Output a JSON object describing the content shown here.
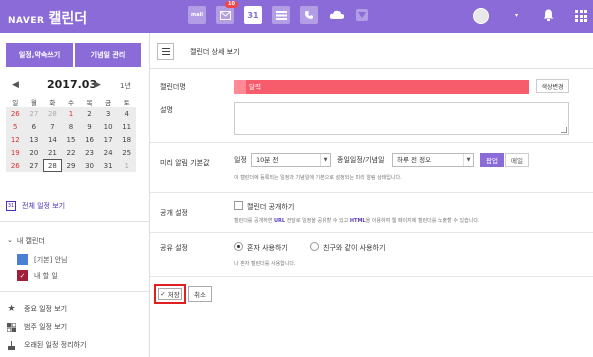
{
  "header": {
    "brand": "NAVER",
    "app_name": "캘린더",
    "apps": [
      {
        "icon": "mail-icon",
        "label": "mail",
        "badge": ""
      },
      {
        "icon": "memo-icon",
        "label": "",
        "badge": "10"
      },
      {
        "icon": "calendar-icon",
        "label": "31",
        "badge": ""
      },
      {
        "icon": "list-icon",
        "label": "",
        "badge": ""
      },
      {
        "icon": "contacts-icon",
        "label": "",
        "badge": ""
      },
      {
        "icon": "cloud-icon",
        "label": "",
        "badge": ""
      },
      {
        "icon": "box-icon",
        "label": "",
        "badge": ""
      }
    ],
    "avatar_caret": "▾"
  },
  "sidebar": {
    "new_event_label": "일정,약속쓰기",
    "anniversary_label": "기념일 관리",
    "mini_cal": {
      "month_label": "2017.03",
      "prev": "◀",
      "next": "▶",
      "jump_label": "1년",
      "weekdays": [
        "일",
        "월",
        "화",
        "수",
        "목",
        "금",
        "토"
      ]
    },
    "all_events_label": "전체 일정 보기",
    "cal31": "31",
    "my_calendars_label": "내 캘린더",
    "my_calendars_toggle": "⌄",
    "calendars": [
      {
        "label": "[기본] 안님",
        "color": "#4a7fd8"
      },
      {
        "label": "내 할 일",
        "color": "#a0203a"
      }
    ],
    "tools": [
      {
        "label": "중요 일정 보기",
        "icon": "star-icon"
      },
      {
        "label": "범주 일정 보기",
        "icon": "category-icon"
      },
      {
        "label": "오래된 일정 정리하기",
        "icon": "cleanup-icon"
      }
    ]
  },
  "calendar_grid": [
    [
      {
        "d": "26",
        "c": "sun dim"
      },
      {
        "d": "27",
        "c": "dim"
      },
      {
        "d": "28",
        "c": "dim"
      },
      {
        "d": "1",
        "c": "sun"
      },
      {
        "d": "2",
        "c": ""
      },
      {
        "d": "3",
        "c": ""
      },
      {
        "d": "4",
        "c": ""
      }
    ],
    [
      {
        "d": "5",
        "c": "sun"
      },
      {
        "d": "6",
        "c": ""
      },
      {
        "d": "7",
        "c": ""
      },
      {
        "d": "8",
        "c": ""
      },
      {
        "d": "9",
        "c": ""
      },
      {
        "d": "10",
        "c": ""
      },
      {
        "d": "11",
        "c": ""
      }
    ],
    [
      {
        "d": "12",
        "c": "sun"
      },
      {
        "d": "13",
        "c": ""
      },
      {
        "d": "14",
        "c": ""
      },
      {
        "d": "15",
        "c": ""
      },
      {
        "d": "16",
        "c": ""
      },
      {
        "d": "17",
        "c": ""
      },
      {
        "d": "18",
        "c": ""
      }
    ],
    [
      {
        "d": "19",
        "c": "sun"
      },
      {
        "d": "20",
        "c": ""
      },
      {
        "d": "21",
        "c": ""
      },
      {
        "d": "22",
        "c": ""
      },
      {
        "d": "23",
        "c": ""
      },
      {
        "d": "24",
        "c": ""
      },
      {
        "d": "25",
        "c": ""
      }
    ],
    [
      {
        "d": "26",
        "c": "sun"
      },
      {
        "d": "27",
        "c": ""
      },
      {
        "d": "28",
        "c": "today"
      },
      {
        "d": "29",
        "c": ""
      },
      {
        "d": "30",
        "c": ""
      },
      {
        "d": "31",
        "c": ""
      },
      {
        "d": "1",
        "c": "dim"
      }
    ]
  ],
  "main": {
    "title": "캘린더 상세 보기",
    "name_label": "캘린더명",
    "name_value": "달력",
    "color_change_label": "색상변경",
    "desc_label": "설명",
    "reminder_label": "미리 알림 기본값",
    "event_label": "일정",
    "event_select": "10분 전",
    "allday_label": "종일일정/기념일",
    "allday_select": "하루 전 정오",
    "popup_label": "팝업",
    "mail_label": "메일",
    "reminder_hint": "이 캘린더에 등록되는 일정과 기념일에 기본으로 설정되는 미리 알림 상태입니다.",
    "public_label": "공개 설정",
    "public_checkbox_label": "캘린더 공개하기",
    "public_hint_pre": "캘린더를 공개하면",
    "public_hint_url": "URL",
    "public_hint_mid": "전달로 일정을 공유할 수 있고",
    "public_hint_html": "HTML",
    "public_hint_post": "을 이용하여 웹 페이지에 캘린더를 노출할 수 있습니다.",
    "share_label": "공유 설정",
    "share_alone": "혼자 사용하기",
    "share_friends": "친구와 같이 사용하기",
    "share_hint": "나 혼자 캘린더를 사용합니다.",
    "save_label": "저장",
    "save_check": "✓",
    "cancel_label": "취소"
  }
}
